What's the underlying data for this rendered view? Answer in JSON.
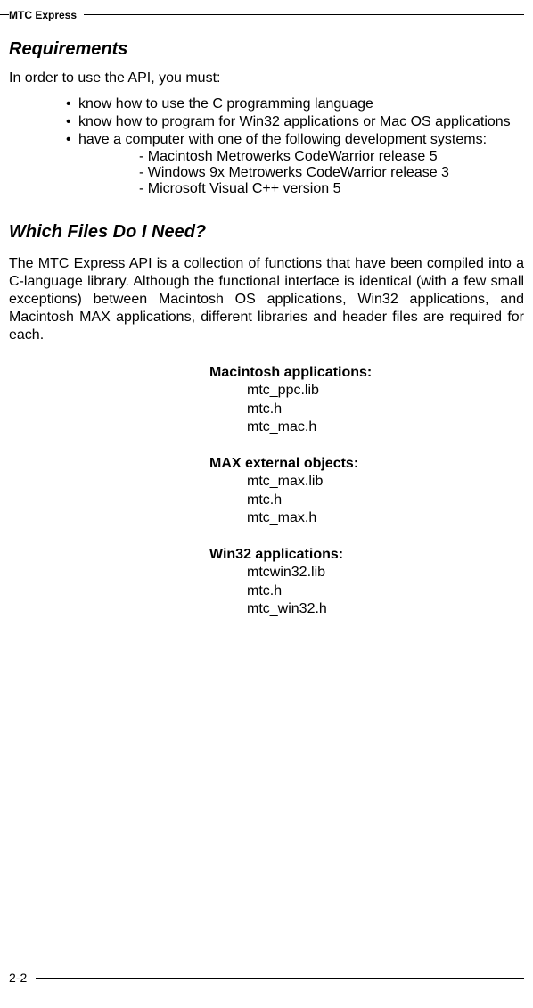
{
  "running_head": "MTC Express",
  "sections": {
    "requirements": {
      "heading": "Requirements",
      "intro": "In order to use the API, you must:",
      "bullets": [
        "know how to use the C programming language",
        "know how to program for Win32 applications or Mac OS applications",
        "have a computer with one of the following development systems:"
      ],
      "sub_bullets": [
        "- Macintosh Metrowerks CodeWarrior release 5",
        "- Windows 9x Metrowerks CodeWarrior release 3",
        "- Microsoft Visual C++ version 5"
      ]
    },
    "which_files": {
      "heading": "Which Files Do I Need?",
      "para": "The MTC Express API is a collection of functions that have been compiled into a C-language library.   Although the functional interface is identical (with a few small exceptions) between Macintosh OS applications, Win32 applications, and Macintosh MAX applications, different libraries and header files are required for each.",
      "groups": [
        {
          "title": "Macintosh applications:",
          "files": [
            "mtc_ppc.lib",
            "mtc.h",
            "mtc_mac.h"
          ]
        },
        {
          "title": "MAX external objects:",
          "files": [
            "mtc_max.lib",
            "mtc.h",
            "mtc_max.h"
          ]
        },
        {
          "title": "Win32 applications:",
          "files": [
            "mtcwin32.lib",
            "mtc.h",
            "mtc_win32.h"
          ]
        }
      ]
    }
  },
  "page_number": "2-2"
}
